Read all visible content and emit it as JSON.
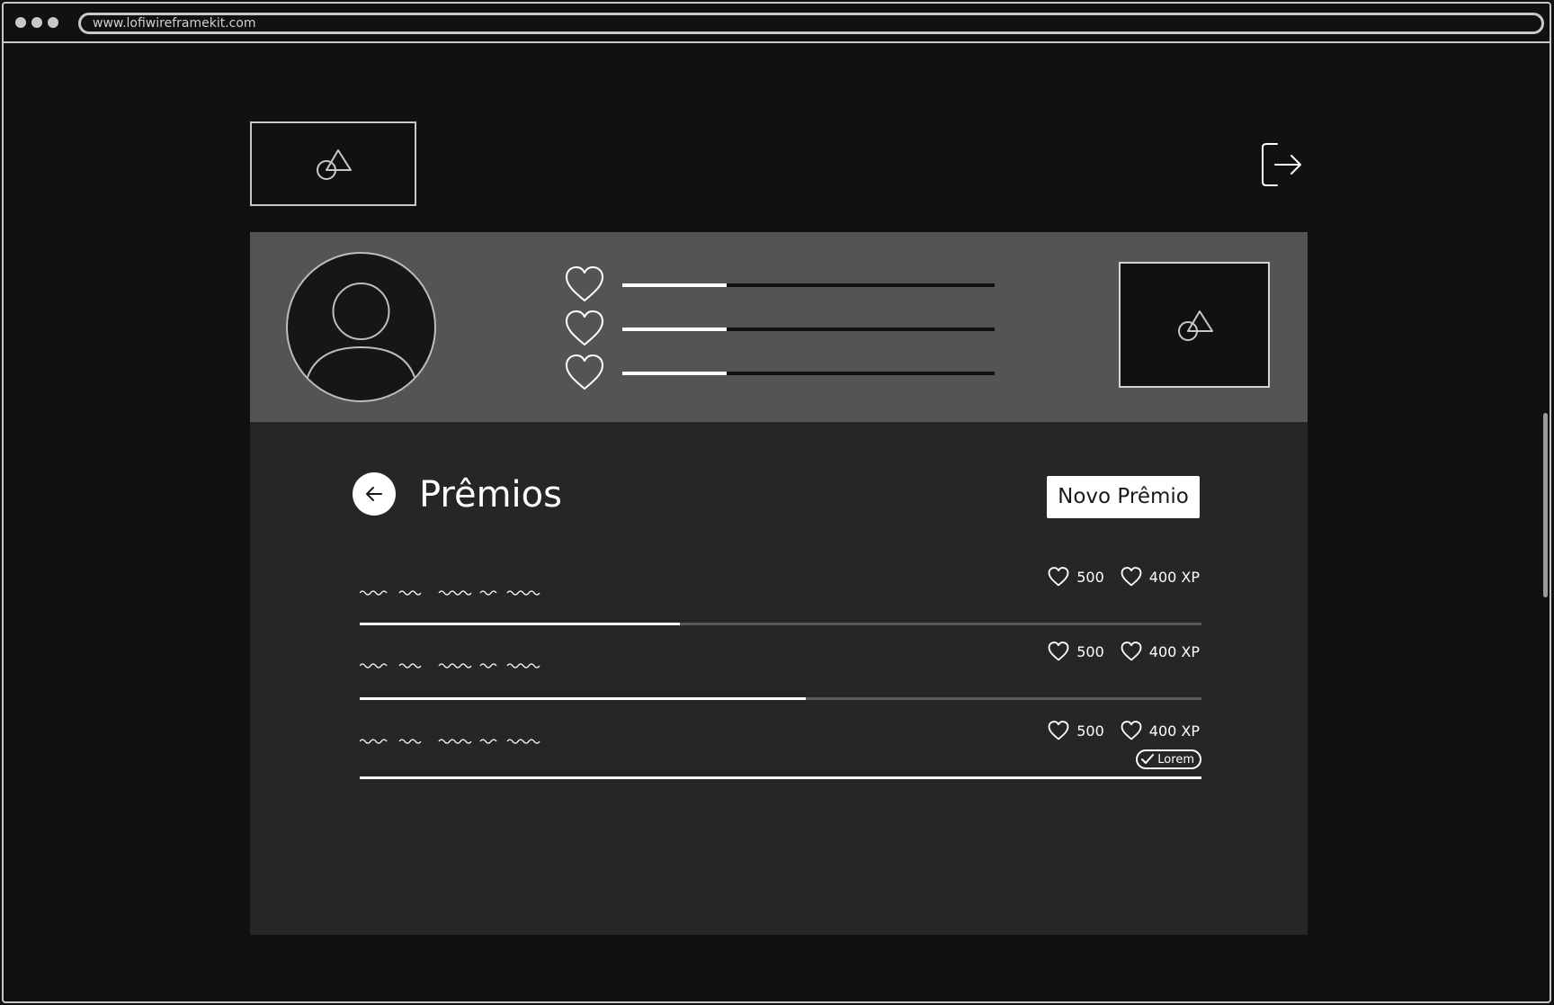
{
  "browser": {
    "url": "www.lofiwireframekit.com"
  },
  "header": {
    "logo_icon": "image-placeholder-icon",
    "logout_icon": "logout-icon"
  },
  "profile": {
    "avatar_icon": "user-avatar-icon",
    "stats": [
      {
        "icon": "heart-icon",
        "progress": 0.28
      },
      {
        "icon": "heart-icon",
        "progress": 0.28
      },
      {
        "icon": "heart-icon",
        "progress": 0.28
      }
    ],
    "media_icon": "image-placeholder-icon"
  },
  "page": {
    "back_icon": "arrow-left-icon",
    "title": "Prêmios",
    "new_button_label": "Novo Prêmio"
  },
  "rewards": [
    {
      "hearts": "500",
      "xp": "400 XP",
      "progress": 0.38
    },
    {
      "hearts": "500",
      "xp": "400 XP",
      "progress": 0.53
    },
    {
      "hearts": "500",
      "xp": "400 XP",
      "progress": 1.0,
      "badge": "Lorem",
      "badge_icon": "check-icon"
    }
  ],
  "colors": {
    "background": "#111111",
    "header_band": "#545454",
    "content_panel": "#262626",
    "accent": "#ffffff"
  }
}
